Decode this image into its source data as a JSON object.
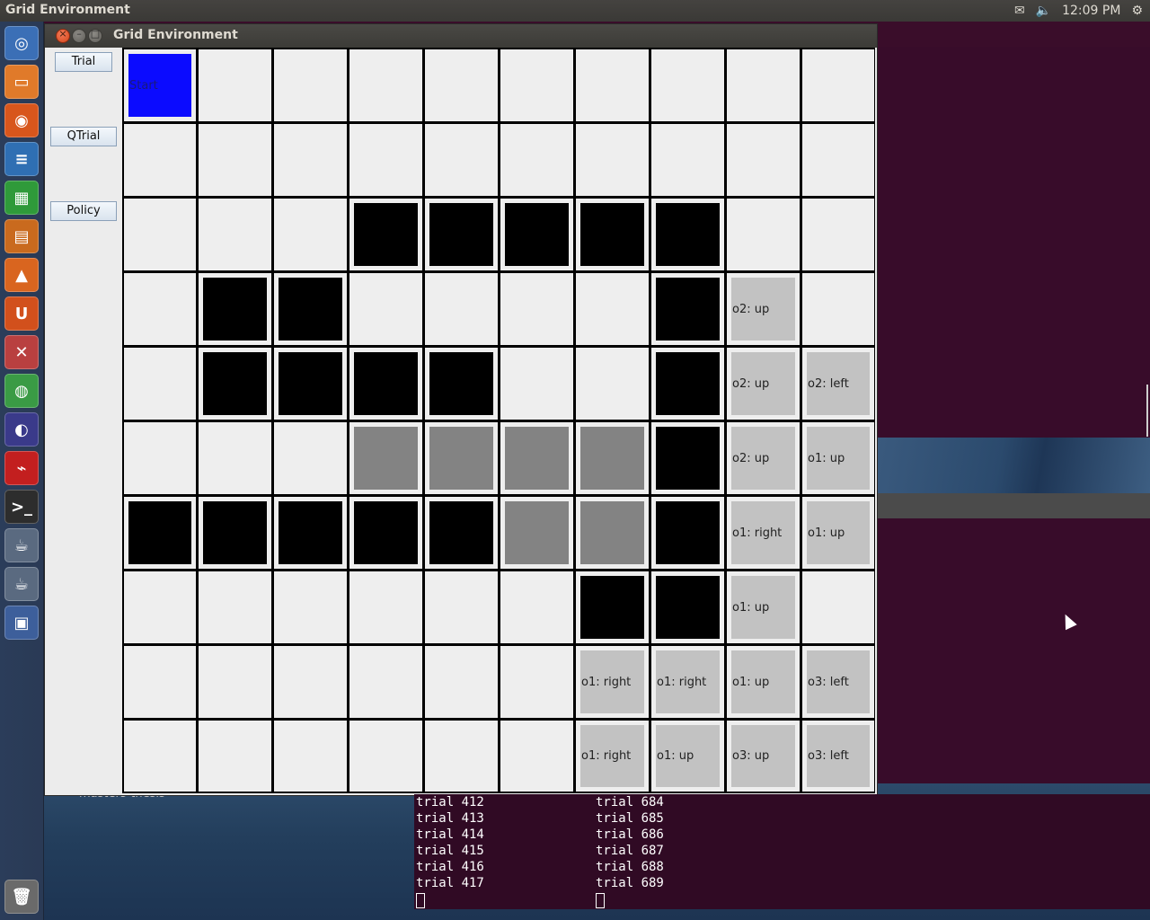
{
  "top_panel": {
    "app_title": "Grid Environment",
    "time": "12:09 PM",
    "icons": [
      "mail-icon",
      "volume-icon",
      "gear-icon"
    ]
  },
  "launcher": {
    "items": [
      {
        "name": "dash-icon",
        "color": "#3b6fb6",
        "glyph": "◎"
      },
      {
        "name": "files-icon",
        "color": "#e07a2a",
        "glyph": "▭"
      },
      {
        "name": "firefox-icon",
        "color": "#d8561c",
        "glyph": "◉"
      },
      {
        "name": "writer-icon",
        "color": "#2f6fb3",
        "glyph": "≡"
      },
      {
        "name": "calc-icon",
        "color": "#2f9a3a",
        "glyph": "▦"
      },
      {
        "name": "impress-icon",
        "color": "#c96a1e",
        "glyph": "▤"
      },
      {
        "name": "software-center-icon",
        "color": "#d9651f",
        "glyph": "▲"
      },
      {
        "name": "ubuntu-one-icon",
        "color": "#d2501c",
        "glyph": "U"
      },
      {
        "name": "system-settings-icon",
        "color": "#b94040",
        "glyph": "✕"
      },
      {
        "name": "chrome-icon",
        "color": "#3a9b45",
        "glyph": "◍"
      },
      {
        "name": "eclipse-icon",
        "color": "#3a3a8a",
        "glyph": "◐"
      },
      {
        "name": "acrobat-icon",
        "color": "#c31f1f",
        "glyph": "⌁"
      },
      {
        "name": "terminal-icon",
        "color": "#2d2d2d",
        "glyph": ">_"
      },
      {
        "name": "java-icon-1",
        "color": "#5a6a80",
        "glyph": "☕"
      },
      {
        "name": "java-icon-2",
        "color": "#5a6a80",
        "glyph": "☕"
      },
      {
        "name": "workspace-switcher-icon",
        "color": "#3d5f9b",
        "glyph": "▣"
      },
      {
        "name": "trash-icon",
        "color": "#6a6a6a",
        "glyph": "🗑"
      }
    ]
  },
  "window": {
    "title": "Grid Environment",
    "buttons": {
      "trial": "Trial",
      "qtrial": "QTrial",
      "policy": "Policy"
    },
    "grid": {
      "rows": 10,
      "cols": 10,
      "cells": [
        [
          "S",
          "",
          "",
          "",
          "",
          "",
          "",
          "",
          "",
          ""
        ],
        [
          "",
          "",
          "",
          "",
          "",
          "",
          "",
          "",
          "",
          ""
        ],
        [
          "",
          "",
          "",
          "X",
          "X",
          "X",
          "X",
          "X",
          "",
          ""
        ],
        [
          "",
          "X",
          "X",
          "",
          "",
          "",
          "",
          "X",
          "o2: up",
          ""
        ],
        [
          "",
          "X",
          "X",
          "X",
          "X",
          "",
          "",
          "X",
          "o2: up",
          "o2: left"
        ],
        [
          "",
          "",
          "",
          "W",
          "W",
          "W",
          "W",
          "X",
          "o2: up",
          "o1: up"
        ],
        [
          "X",
          "X",
          "X",
          "X",
          "X",
          "W",
          "W",
          "X",
          "o1: right",
          "o1: up"
        ],
        [
          "",
          "",
          "",
          "",
          "",
          "",
          "X",
          "X",
          "o1: up",
          ""
        ],
        [
          "",
          "",
          "",
          "",
          "",
          "",
          "o1: right",
          "o1: right",
          "o1: up",
          "o3: left"
        ],
        [
          "",
          "",
          "",
          "",
          "",
          "",
          "o1: right",
          "o1: up",
          "o3: up",
          "o3: left"
        ]
      ],
      "start_label": "Start",
      "colors": {
        "start": "#0b0bff",
        "obstacle": "#000000",
        "water": "#838383",
        "option": "#c2c2c2",
        "empty": "#eeeeee"
      }
    }
  },
  "desktop": {
    "folder_label": "masters-thesis"
  },
  "terminals": [
    {
      "lines": [
        "trial 412",
        "trial 413",
        "trial 414",
        "trial 415",
        "trial 416",
        "trial 417"
      ]
    },
    {
      "lines": [
        "trial 684",
        "trial 685",
        "trial 686",
        "trial 687",
        "trial 688",
        "trial 689"
      ]
    }
  ]
}
